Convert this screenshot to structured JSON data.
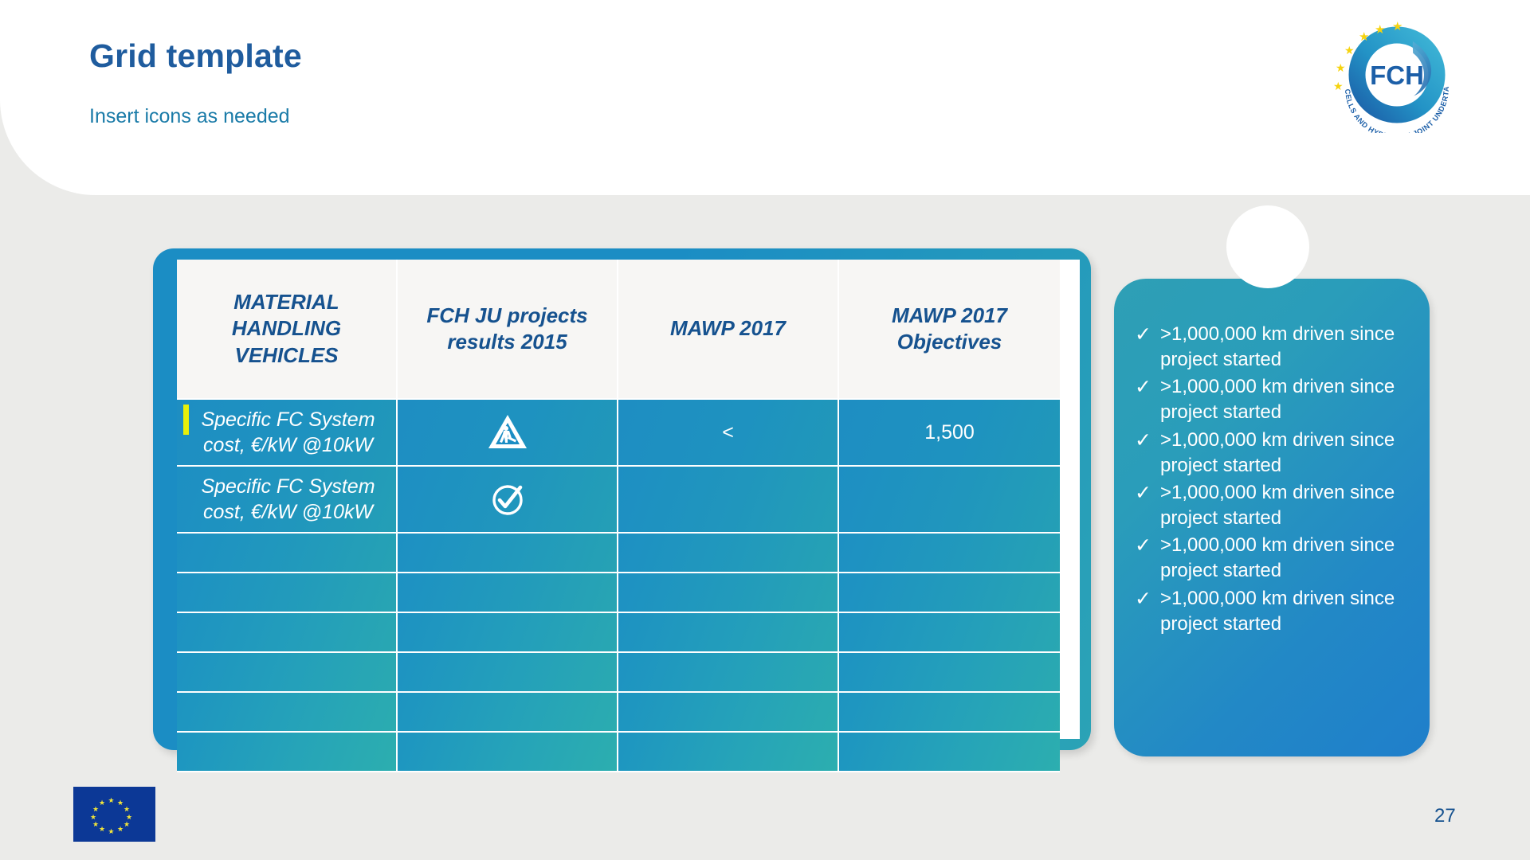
{
  "slide": {
    "title": "Grid template",
    "subtitle": "Insert icons as needed",
    "page_number": "27",
    "background_color": "#ebebe9",
    "accent_blue": "#1b8dc4",
    "title_color": "#1f5c9e",
    "subtitle_color": "#1a7ba8"
  },
  "logo": {
    "name": "FCH",
    "acronym": "FCH",
    "tagline": "FUEL CELLS AND HYDROGEN JOINT UNDERTAKING"
  },
  "table": {
    "headers": [
      "MATERIAL HANDLING VEHICLES",
      "FCH JU projects results 2015",
      "MAWP 2017",
      "MAWP 2017 Objectives"
    ],
    "rows": [
      {
        "label": "Specific FC System cost, €/kW @10kW",
        "has_caret": true,
        "icon": "roadworks-icon",
        "mawp_2017": "<",
        "mawp_2017_objectives": "1,500"
      },
      {
        "label": "Specific FC System cost, €/kW @10kW",
        "has_caret": false,
        "icon": "check-circle-icon",
        "mawp_2017": "",
        "mawp_2017_objectives": ""
      },
      {
        "label": "",
        "has_caret": false,
        "icon": "",
        "mawp_2017": "",
        "mawp_2017_objectives": ""
      },
      {
        "label": "",
        "has_caret": false,
        "icon": "",
        "mawp_2017": "",
        "mawp_2017_objectives": ""
      },
      {
        "label": "",
        "has_caret": false,
        "icon": "",
        "mawp_2017": "",
        "mawp_2017_objectives": ""
      },
      {
        "label": "",
        "has_caret": false,
        "icon": "",
        "mawp_2017": "",
        "mawp_2017_objectives": ""
      },
      {
        "label": "",
        "has_caret": false,
        "icon": "",
        "mawp_2017": "",
        "mawp_2017_objectives": ""
      },
      {
        "label": "",
        "has_caret": false,
        "icon": "",
        "mawp_2017": "",
        "mawp_2017_objectives": ""
      }
    ]
  },
  "checklist": {
    "tick_glyph": "✓",
    "items": [
      ">1,000,000 km driven since project started",
      ">1,000,000 km driven since project started",
      ">1,000,000 km driven since project started",
      ">1,000,000 km driven since project started",
      ">1,000,000 km driven since project started",
      ">1,000,000 km driven since project started"
    ]
  },
  "footer": {
    "eu_flag_label": "European Union flag"
  }
}
